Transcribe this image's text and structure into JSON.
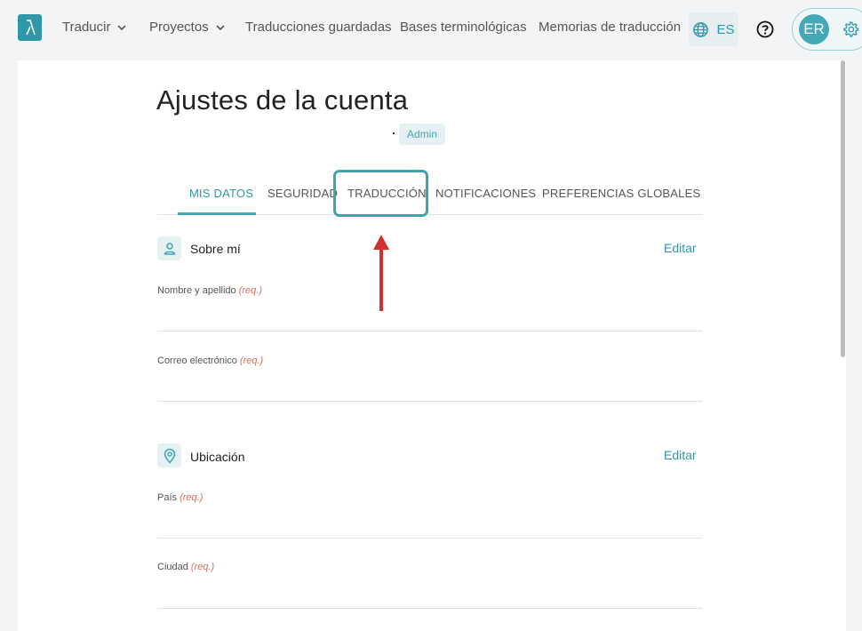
{
  "nav": {
    "translate": "Traducir",
    "projects": "Proyectos",
    "saved": "Traducciones guardadas",
    "termbases": "Bases terminológicas",
    "memories": "Memorias de traducción",
    "language": "ES",
    "user_initials": "ER"
  },
  "page": {
    "title": "Ajustes de la cuenta",
    "role_badge": "Admin"
  },
  "tabs": [
    {
      "label": "MIS DATOS",
      "active": true
    },
    {
      "label": "SEGURIDAD",
      "active": false
    },
    {
      "label": "TRADUCCIÓN",
      "active": false,
      "highlighted": true
    },
    {
      "label": "NOTIFICACIONES",
      "active": false
    },
    {
      "label": "PREFERENCIAS GLOBALES",
      "active": false
    }
  ],
  "sections": {
    "about": {
      "title": "Sobre mí",
      "edit": "Editar",
      "fields": [
        {
          "label": "Nombre y apellido",
          "req": "(req.)"
        },
        {
          "label": "Correo electrónico",
          "req": "(req.)"
        }
      ]
    },
    "location": {
      "title": "Ubicación",
      "edit": "Editar",
      "fields": [
        {
          "label": "País",
          "req": "(req.)"
        },
        {
          "label": "Ciudad",
          "req": "(req.)"
        }
      ]
    }
  },
  "colors": {
    "accent": "#2f97a8",
    "annotation_arrow": "#d32f2f",
    "required": "#d0705c"
  }
}
